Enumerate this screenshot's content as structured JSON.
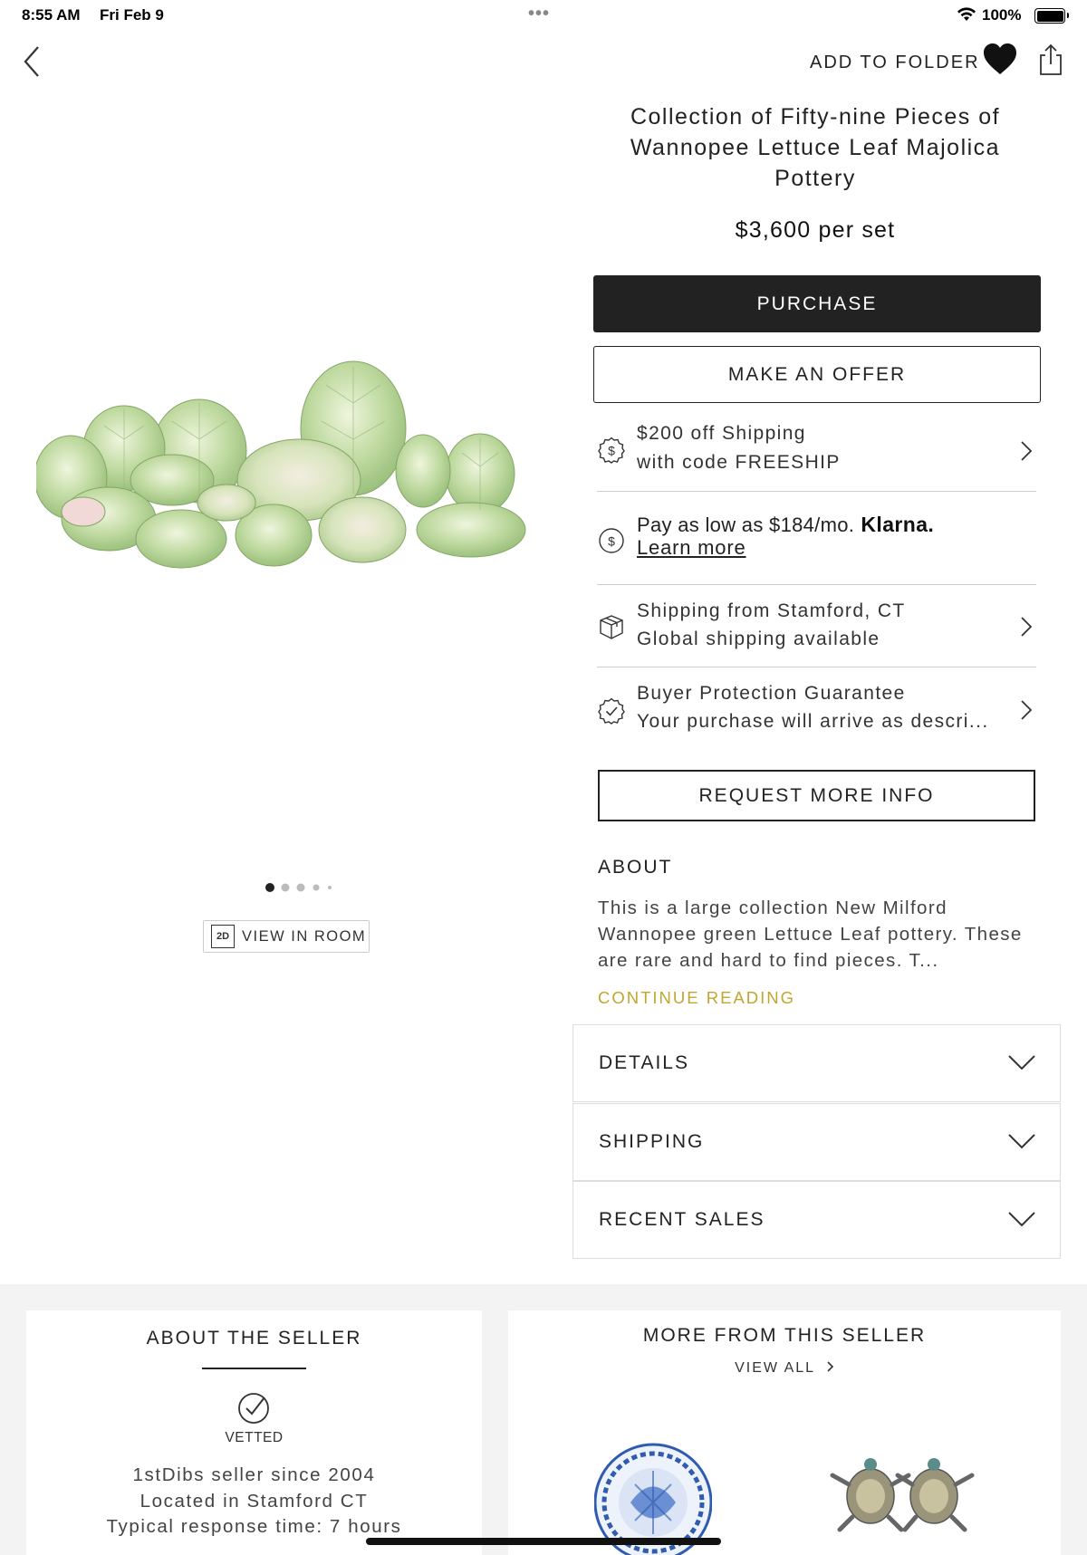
{
  "status_bar": {
    "time": "8:55 AM",
    "date": "Fri Feb 9",
    "dots": "•••",
    "battery": "100%"
  },
  "header": {
    "back_icon": "chevron-left-icon",
    "add_to_folder": "ADD TO FOLDER",
    "heart_icon": "heart-icon",
    "share_icon": "share-icon"
  },
  "product": {
    "title": "Collection of  Fifty-nine Pieces of Wannopee Lettuce Leaf Majolica Pottery",
    "price": "$3,600 per set",
    "purchase_label": "PURCHASE",
    "offer_label": "MAKE AN OFFER"
  },
  "info_rows": {
    "shipping_discount": {
      "line1": "$200 off Shipping",
      "line2": "with code FREESHIP"
    },
    "klarna": {
      "text": "Pay as low as $184/mo.",
      "logo": "Klarna.",
      "link": "Learn more"
    },
    "ships_from": {
      "line1": "Shipping from Stamford, CT",
      "line2": "Global shipping available"
    },
    "buyer_protection": {
      "line1": "Buyer Protection Guarantee",
      "line2": "Your purchase will arrive as descri..."
    }
  },
  "request_label": "REQUEST MORE INFO",
  "about": {
    "heading": "ABOUT",
    "text": "This is a large collection New Milford Wannopee green Lettuce Leaf pottery. These are rare and hard to find pieces. T...",
    "continue": "CONTINUE READING"
  },
  "accordions": {
    "details": "DETAILS",
    "shipping": "SHIPPING",
    "recent_sales": "RECENT SALES"
  },
  "gallery": {
    "dots_count": 5,
    "active_dot": 0,
    "badge": "2D",
    "view_in_room": "VIEW IN ROOM"
  },
  "seller": {
    "title": "ABOUT THE SELLER",
    "vetted": "VETTED",
    "since": "1stDibs seller since 2004",
    "location": "Located in Stamford CT",
    "response": "Typical response time: 7 hours"
  },
  "more": {
    "title": "MORE FROM THIS SELLER",
    "view_all": "VIEW ALL",
    "view_all_icon": "chevron-right-icon"
  },
  "colors": {
    "accent_gold": "#c2a630",
    "button_dark": "#222222",
    "lettuce_green": "#b9d79a"
  }
}
